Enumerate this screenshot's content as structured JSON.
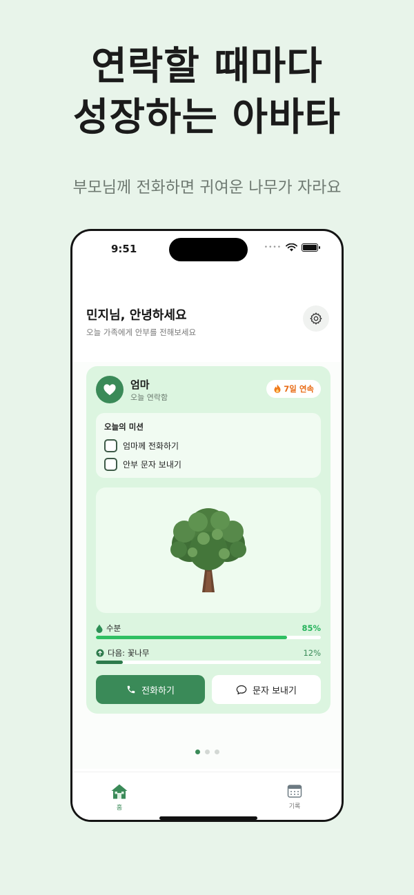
{
  "promo": {
    "headline_line1": "연락할 때마다",
    "headline_line2": "성장하는 아바타",
    "subheadline": "부모님께 전화하면 귀여운 나무가 자라요"
  },
  "status_bar": {
    "time": "9:51"
  },
  "header": {
    "greeting": "민지님, 안녕하세요",
    "subtitle": "오늘 가족에게 안부를 전해보세요"
  },
  "contact_card": {
    "name": "엄마",
    "last_contact": "오늘 연락함",
    "streak_label": "7일 연속",
    "missions_title": "오늘의 미션",
    "missions": [
      {
        "label": "엄마께 전화하기",
        "checked": false
      },
      {
        "label": "안부 문자 보내기",
        "checked": false
      }
    ],
    "stats": {
      "water_label": "수분",
      "water_value_text": "85%",
      "water_value": 85,
      "next_label": "다음: 꽃나무",
      "next_value_text": "12%",
      "next_value": 12
    },
    "call_button": "전화하기",
    "message_button": "문자 보내기"
  },
  "pagination": {
    "count": 3,
    "active": 0
  },
  "tabbar": {
    "home_label": "홈",
    "log_label": "기록"
  },
  "colors": {
    "background": "#e8f4ea",
    "accent": "#3a8a58",
    "progress_green": "#2fbf62",
    "streak_orange": "#e86b15",
    "card": "#dcf5e0"
  }
}
